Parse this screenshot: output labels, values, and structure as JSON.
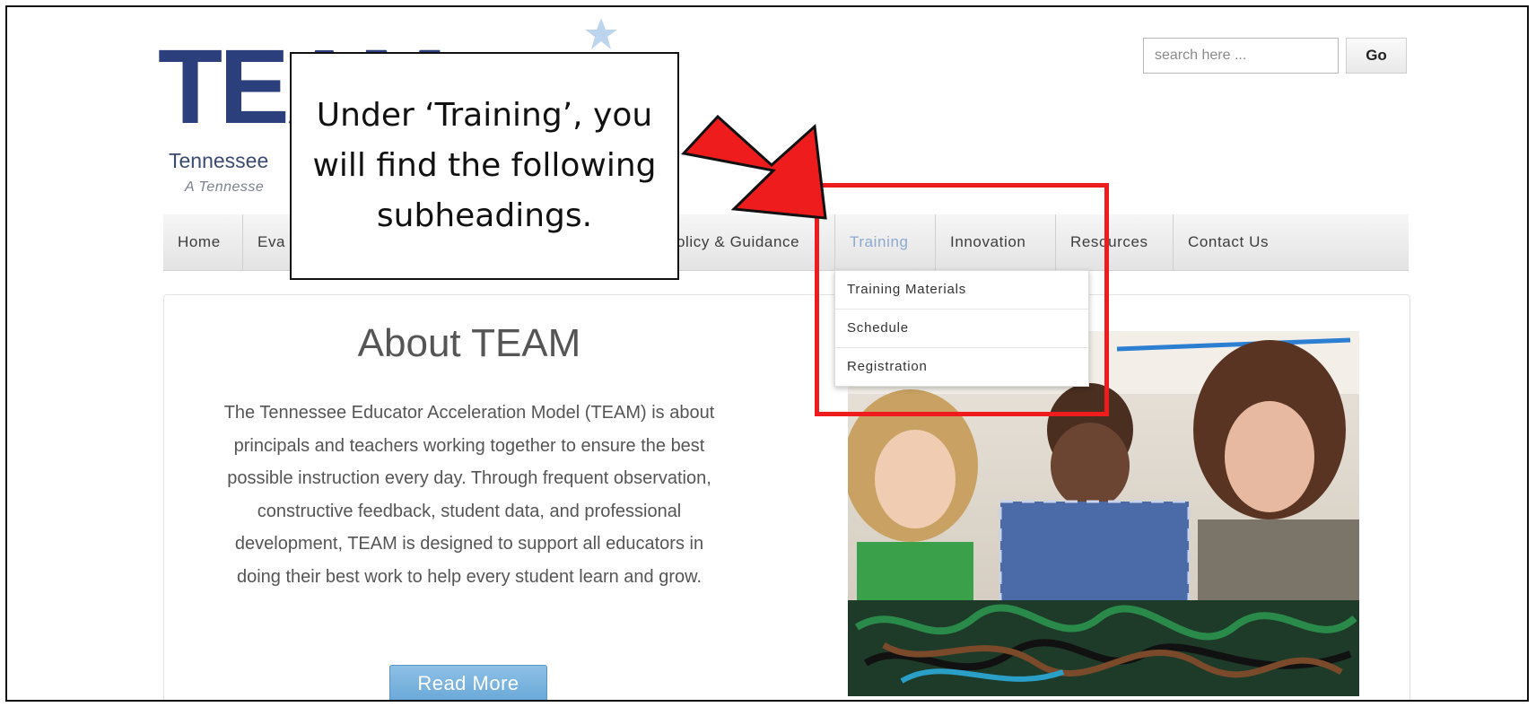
{
  "logo": {
    "big_text": "TEAM",
    "subtitle": "Tennessee",
    "tagline": "A Tennesse"
  },
  "search": {
    "placeholder": "search here ...",
    "button_label": "Go"
  },
  "nav": {
    "items": [
      {
        "label": "Home"
      },
      {
        "label": "Eva"
      },
      {
        "label": "olicy & Guidance"
      },
      {
        "label": "Training"
      },
      {
        "label": "Innovation"
      },
      {
        "label": "Resources"
      },
      {
        "label": "Contact Us"
      }
    ],
    "active_item": "Training"
  },
  "dropdown": {
    "items": [
      {
        "label": "Training Materials"
      },
      {
        "label": "Schedule"
      },
      {
        "label": "Registration"
      }
    ]
  },
  "about": {
    "title": "About TEAM",
    "body": "The Tennessee Educator Acceleration Model (TEAM) is about principals and teachers working together to ensure the best possible instruction every day. Through frequent observation, constructive feedback, student data, and professional development, TEAM is designed to support all educators in doing their best work to help every student learn and grow.",
    "read_more_label": "Read More"
  },
  "callout": {
    "text": "Under ‘Training’, you will find the following subheadings."
  },
  "colors": {
    "logo_blue": "#2b3f7d",
    "highlight_red": "#ee1c1c",
    "active_nav": "#8ea9cf",
    "button_blue": "#6aa8d8"
  }
}
